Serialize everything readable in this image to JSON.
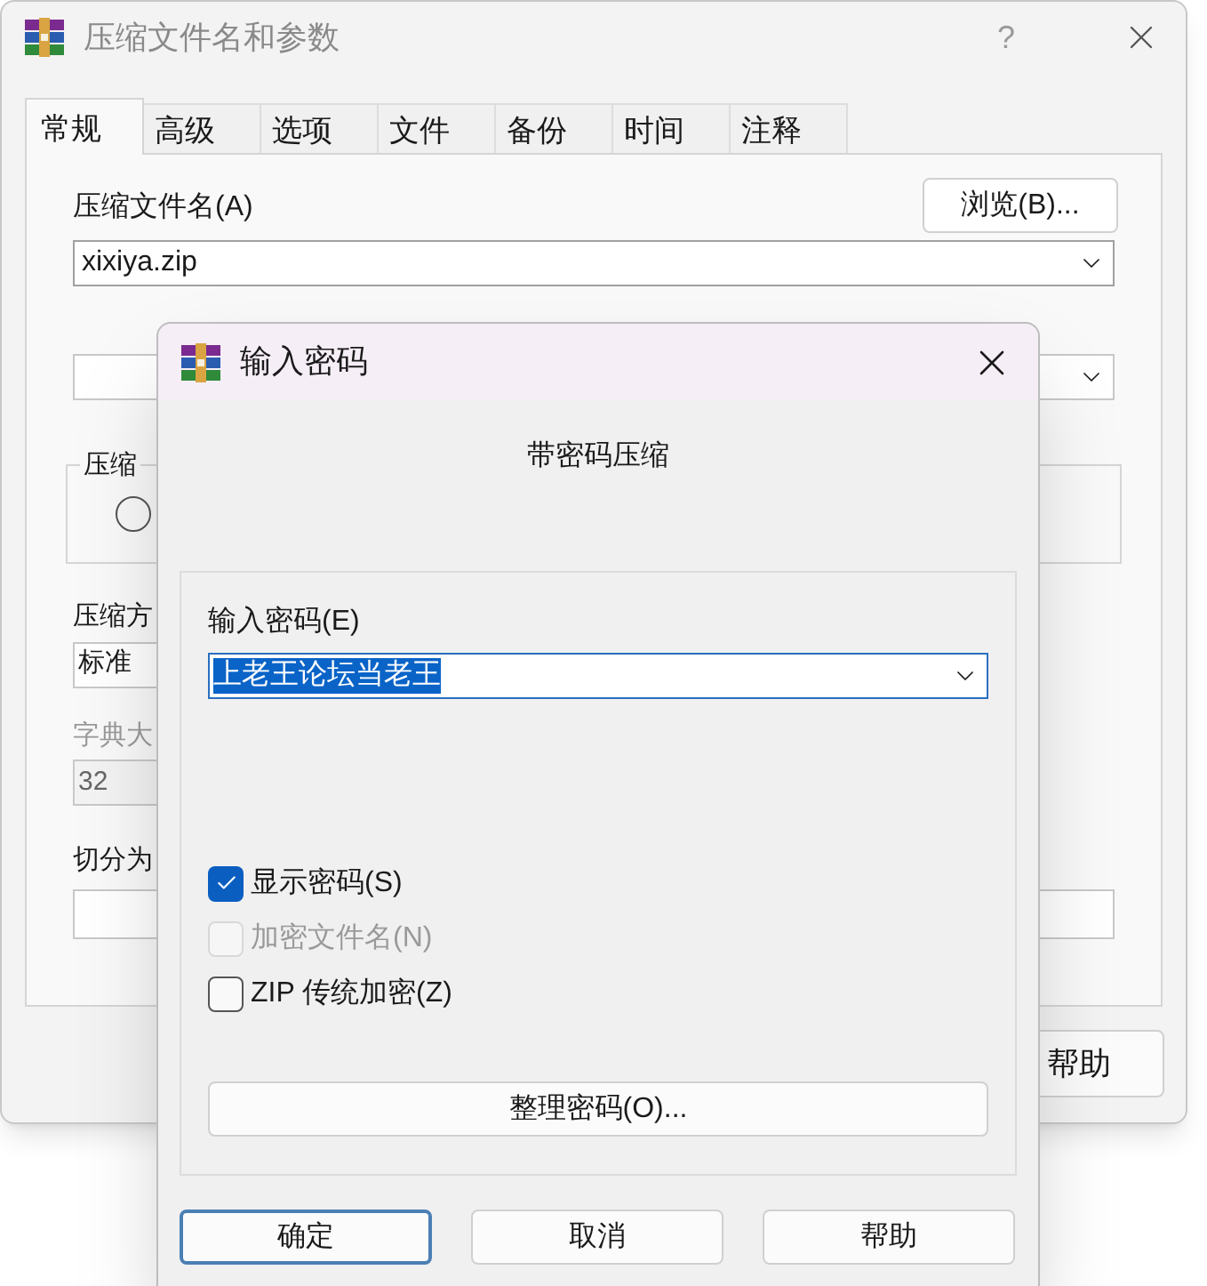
{
  "window": {
    "title": "压缩文件名和参数",
    "help": "?"
  },
  "tabs": [
    {
      "label": "常规",
      "selected": true
    },
    {
      "label": "高级",
      "selected": false
    },
    {
      "label": "选项",
      "selected": false
    },
    {
      "label": "文件",
      "selected": false
    },
    {
      "label": "备份",
      "selected": false
    },
    {
      "label": "时间",
      "selected": false
    },
    {
      "label": "注释",
      "selected": false
    }
  ],
  "archive_name": {
    "label": "压缩文件名(A)",
    "value": "xixiya.zip"
  },
  "browse_button": "浏览(B)...",
  "group_label": "压缩",
  "radio": {
    "selected": false
  },
  "method": {
    "label": "压缩方",
    "value": "标准"
  },
  "dictionary": {
    "label": "字典大",
    "value": "32",
    "disabled": true
  },
  "split": {
    "label": "切分为"
  },
  "help_button": "帮助",
  "password_dialog": {
    "title": "输入密码",
    "subtitle": "带密码压缩",
    "password": {
      "label": "输入密码(E)",
      "value": "上老王论坛当老王",
      "selected": true
    },
    "options": [
      {
        "label": "显示密码(S)",
        "checked": true,
        "disabled": false
      },
      {
        "label": "加密文件名(N)",
        "checked": false,
        "disabled": true
      },
      {
        "label": "ZIP 传统加密(Z)",
        "checked": false,
        "disabled": false
      }
    ],
    "manage_button": "整理密码(O)...",
    "buttons": [
      {
        "label": "确定",
        "default": true
      },
      {
        "label": "取消",
        "default": false
      },
      {
        "label": "帮助",
        "default": false
      }
    ]
  }
}
